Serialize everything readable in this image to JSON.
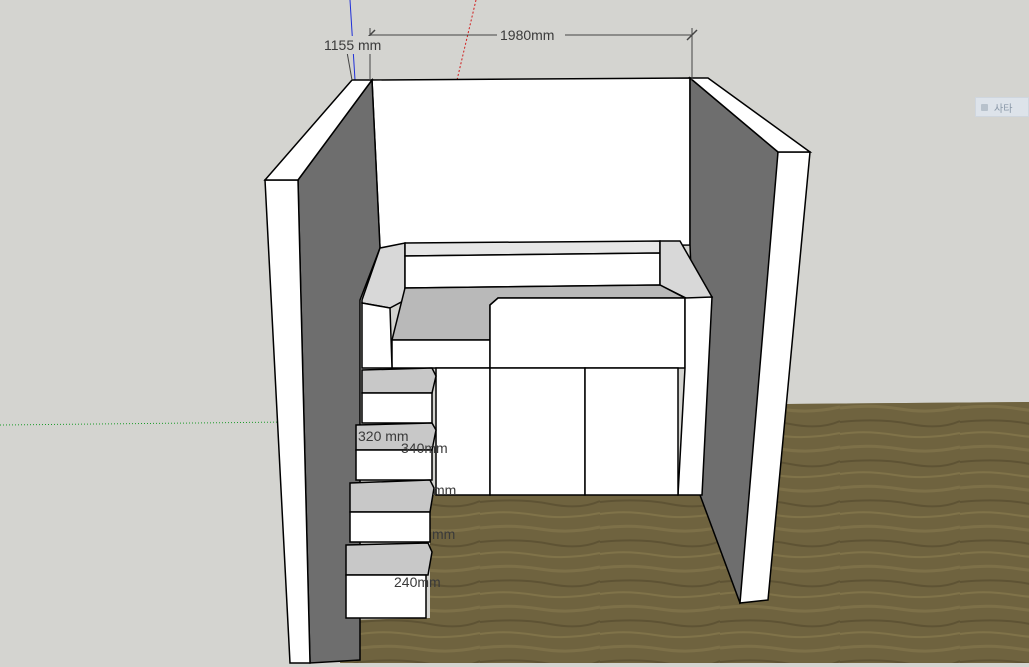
{
  "viewport": {
    "colors": {
      "background": "#d4d4d0",
      "wall_face": "#ffffff",
      "wall_shadow": "#6e6e6e",
      "floor": "#6b5f3c",
      "edge": "#000000"
    }
  },
  "dimensions": {
    "width_top": "1980mm",
    "height_left": "1155 mm",
    "step_depth": "320 mm",
    "step_1": "340mm",
    "step_2": "mm",
    "step_3": "mm",
    "step_4": "240mm"
  },
  "side_panel": {
    "label": "사타"
  },
  "axes": {
    "blue_axis": "#1f2fd8",
    "red_axis": "#d01c1c",
    "green_axis": "#1c9a2a"
  }
}
